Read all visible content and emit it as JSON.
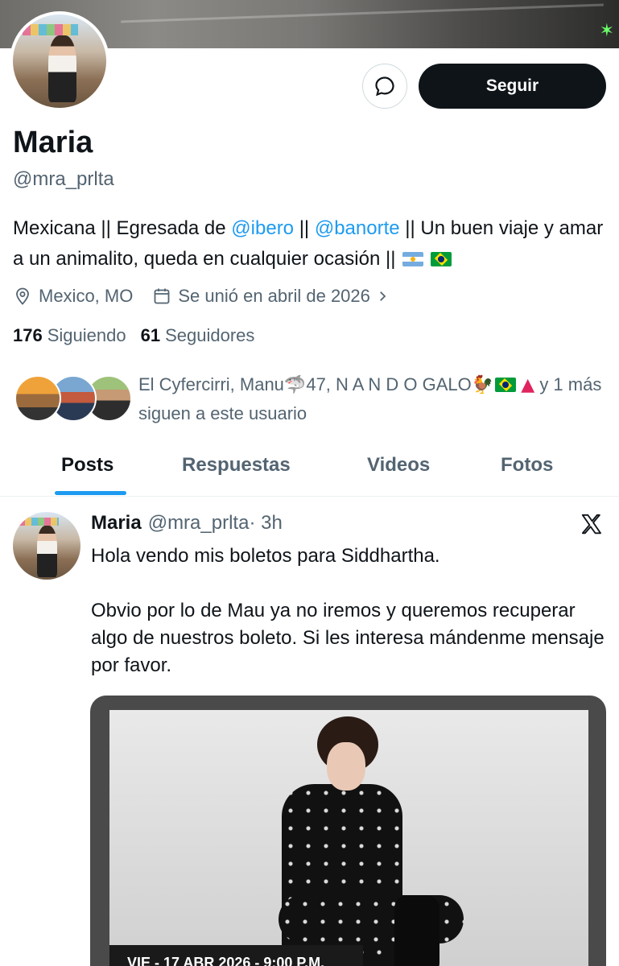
{
  "profile": {
    "display_name": "Maria",
    "handle": "@mra_prlta",
    "bio": {
      "part1": "Mexicana || Egresada de ",
      "mention1": "@ibero",
      "part2": " || ",
      "mention2": "@banorte",
      "part3": " || Un buen viaje y amar a un animalito, queda en cualquier ocasión || "
    },
    "location": "Mexico, MO",
    "joined": "Se unió en abril de 2026",
    "following_count": "176",
    "following_label": "Siguiendo",
    "followers_count": "61",
    "followers_label": "Seguidores",
    "known_followers": {
      "names": "El Cyfercirri, Manu",
      "n47": "47, N A N D O GALO",
      "tail": " y 1 más siguen a este usuario"
    }
  },
  "actions": {
    "follow_label": "Seguir"
  },
  "tabs": [
    {
      "label": "Posts"
    },
    {
      "label": "Respuestas"
    },
    {
      "label": "Videos"
    },
    {
      "label": "Fotos"
    }
  ],
  "post": {
    "name": "Maria",
    "handle": "@mra_prlta",
    "time": " · 3h",
    "text": "Hola vendo mis boletos para Siddhartha.\n\nObvio por lo de Mau ya no iremos y queremos recuperar algo de nuestros boleto. Si les interesa mándenme mensaje por favor.",
    "image_caption": "VIE - 17 ABR 2026 - 9:00 P.M."
  },
  "icons": {
    "message": "message-icon",
    "location": "location-pin-icon",
    "calendar": "calendar-icon",
    "chevron": "chevron-right-icon",
    "x_logo": "x-logo-icon"
  },
  "colors": {
    "accent": "#1d9bf0",
    "text_primary": "#0f1419",
    "text_secondary": "#536471",
    "button_dark": "#0f1419"
  }
}
